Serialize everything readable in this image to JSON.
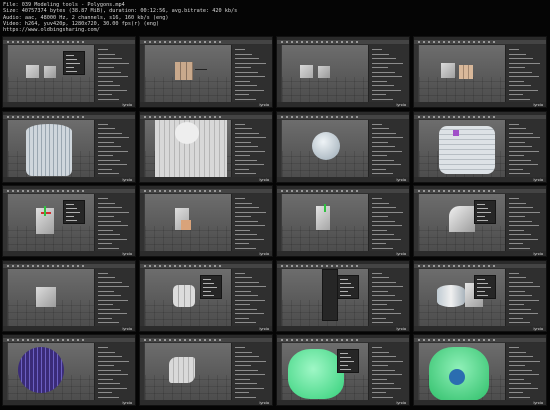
{
  "info_lines": [
    "File: 039 Modeling tools - Polygons.mp4",
    "Size: 40757374 bytes (38.87 MiB), duration: 00:12:56, avg.bitrate: 420 kb/s",
    "Audio: aac, 48000 Hz, 2 channels, s16, 160 kb/s (eng)",
    "Video: h264, yuv420p, 1280x720, 30.00 fps(r) (eng)",
    "https://www.oldbingsharing.com/"
  ],
  "thumbnails": [
    {
      "frame": 1,
      "subject": "two-cubes",
      "popup": true,
      "logo": "lynda"
    },
    {
      "frame": 2,
      "subject": "cube-subdivided",
      "popup": false,
      "logo": "lynda"
    },
    {
      "frame": 3,
      "subject": "two-cubes",
      "popup": false,
      "logo": "lynda"
    },
    {
      "frame": 4,
      "subject": "cube-and-box",
      "popup": false,
      "logo": "lynda"
    },
    {
      "frame": 5,
      "subject": "cylinder-closeup",
      "popup": false,
      "logo": "lynda"
    },
    {
      "frame": 6,
      "subject": "cylinder-cut",
      "popup": false,
      "logo": "lynda"
    },
    {
      "frame": 7,
      "subject": "sphere",
      "popup": false,
      "logo": "lynda"
    },
    {
      "frame": 8,
      "subject": "bevel-closeup",
      "popup": false,
      "logo": "lynda"
    },
    {
      "frame": 9,
      "subject": "cube-with-gizmo",
      "popup": true,
      "logo": "lynda"
    },
    {
      "frame": 10,
      "subject": "extruded-cube",
      "popup": false,
      "logo": "lynda"
    },
    {
      "frame": 11,
      "subject": "tall-box",
      "popup": false,
      "logo": "lynda"
    },
    {
      "frame": 12,
      "subject": "open-shape",
      "popup": true,
      "logo": "lynda"
    },
    {
      "frame": 13,
      "subject": "cube",
      "popup": false,
      "logo": "lynda"
    },
    {
      "frame": 14,
      "subject": "rounded-cube",
      "popup": true,
      "logo": "lynda"
    },
    {
      "frame": 15,
      "subject": "menu-open",
      "popup": true,
      "logo": "lynda"
    },
    {
      "frame": 16,
      "subject": "cylinder-and-box",
      "popup": true,
      "logo": "lynda"
    },
    {
      "frame": 17,
      "subject": "wire-sphere",
      "popup": false,
      "logo": "lynda"
    },
    {
      "frame": 18,
      "subject": "curved-plane",
      "popup": false,
      "logo": "lynda"
    },
    {
      "frame": 19,
      "subject": "green-blob",
      "popup": true,
      "logo": "lynda"
    },
    {
      "frame": 20,
      "subject": "green-character",
      "popup": false,
      "logo": "lynda"
    }
  ]
}
